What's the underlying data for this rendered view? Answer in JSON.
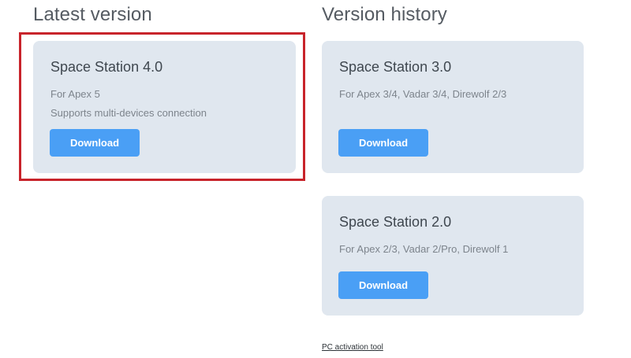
{
  "latest": {
    "section_title": "Latest version",
    "card": {
      "title": "Space Station 4.0",
      "lines": [
        "For Apex 5",
        "Supports multi-devices connection"
      ],
      "button_label": "Download"
    }
  },
  "history": {
    "section_title": "Version history",
    "cards": [
      {
        "title": "Space Station 3.0",
        "lines": [
          "For Apex 3/4, Vadar 3/4, Direwolf 2/3"
        ],
        "button_label": "Download"
      },
      {
        "title": "Space Station 2.0",
        "lines": [
          "For Apex 2/3, Vadar 2/Pro, Direwolf 1"
        ],
        "button_label": "Download"
      }
    ]
  },
  "footer": {
    "pc_activation_link": "PC activation tool"
  },
  "colors": {
    "card_background": "#e0e7ef",
    "button": "#4a9ff5",
    "highlight": "#c8242b"
  }
}
